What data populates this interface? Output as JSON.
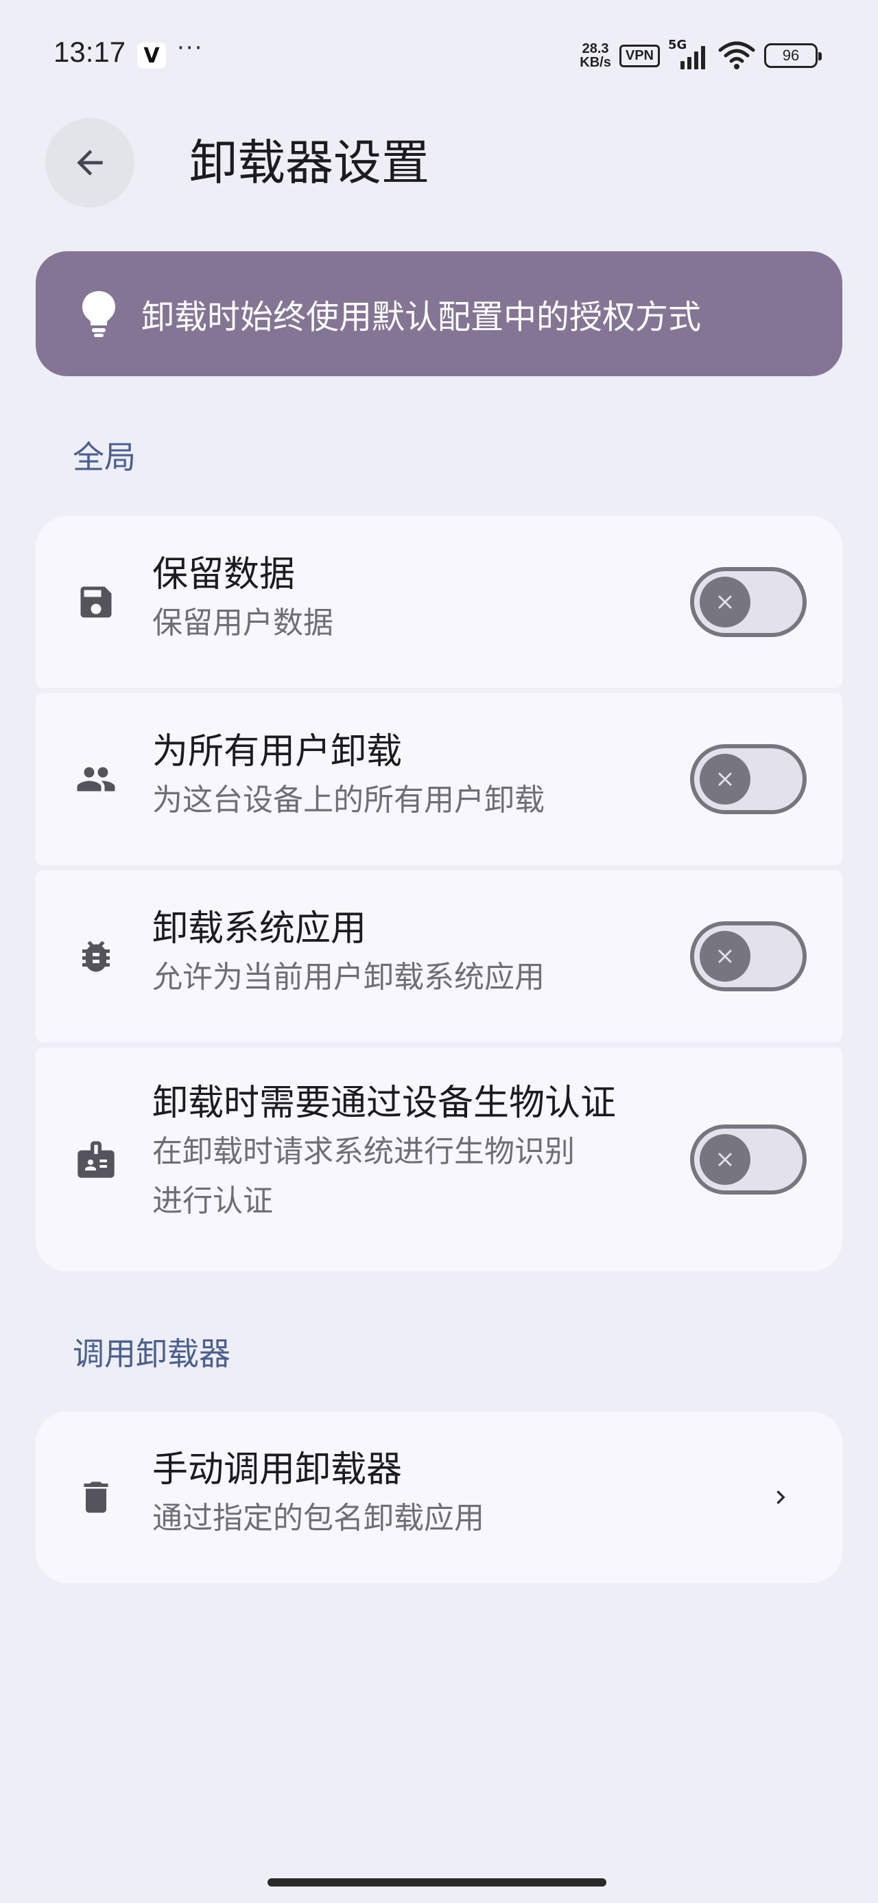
{
  "status_bar": {
    "time": "13:17",
    "app_icon_glyph": "V",
    "more": "···",
    "net_speed_value": "28.3",
    "net_speed_unit": "KB/s",
    "vpn": "VPN",
    "network": "5G",
    "battery": "96"
  },
  "header": {
    "title": "卸载器设置",
    "back_icon": "arrow-back-icon"
  },
  "tip": {
    "icon": "lightbulb-icon",
    "text": "卸载时始终使用默认配置中的授权方式",
    "color": "#847595"
  },
  "sections": [
    {
      "heading": "全局",
      "items": [
        {
          "icon": "save-icon",
          "title": "保留数据",
          "desc": "保留用户数据",
          "control": "switch",
          "checked": false
        },
        {
          "icon": "people-icon",
          "title": "为所有用户卸载",
          "desc": "为这台设备上的所有用户卸载",
          "control": "switch",
          "checked": false
        },
        {
          "icon": "bug-icon",
          "title": "卸载系统应用",
          "desc": "允许为当前用户卸载系统应用",
          "control": "switch",
          "checked": false
        },
        {
          "icon": "badge-icon",
          "title": "卸载时需要通过设备生物认证",
          "desc_line1": "在卸载时请求系统进行生物识别",
          "desc_line2": "进行认证",
          "control": "switch",
          "checked": false
        }
      ]
    },
    {
      "heading": "调用卸载器",
      "items": [
        {
          "icon": "delete-icon",
          "title": "手动调用卸载器",
          "desc": "通过指定的包名卸载应用",
          "control": "chevron"
        }
      ]
    }
  ],
  "colors": {
    "background": "#eeeff6",
    "card": "#f8f7fd",
    "section_heading": "#4b5f8e",
    "switch_off": "#77757f"
  }
}
